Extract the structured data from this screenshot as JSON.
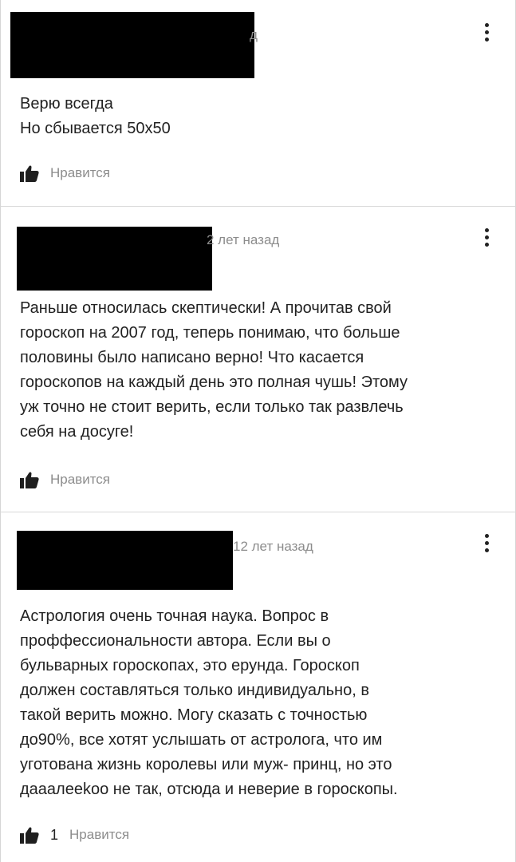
{
  "comments": [
    {
      "time": "д",
      "lines": [
        "Верю всегда",
        "Но сбывается 50х50"
      ],
      "likes": {
        "count": "",
        "label": "Нравится"
      }
    },
    {
      "time": "2 лет назад",
      "lines": [
        "Раньше относилась скептически! А прочитав свой",
        "гороскоп на 2007 год, теперь понимаю, что больше",
        "половины было написано верно! Что касается",
        "гороскопов на каждый день это полная чушь! Этому",
        "уж точно не стоит верить, если только так развлечь",
        "себя на досуге!"
      ],
      "likes": {
        "count": "",
        "label": "Нравится"
      }
    },
    {
      "time": "12 лет назад",
      "lines": [
        "Астрология очень точная наука. Вопрос в",
        "проффессиональности автора. Если вы о",
        "бульварных гороскопах, это ерунда. Гороскоп",
        "должен составляться только индивидуально, в",
        "такой верить можно. Могу сказать с точностью",
        "до90%, все хотят услышать от астролога, что им",
        "уготована жизнь королевы или муж- принц, но это",
        "дааалееkoo не так, отсюда и неверие в гороскопы."
      ],
      "likes": {
        "count": "1",
        "label": "Нравится"
      }
    }
  ],
  "icons": {
    "like": "thumbs-up-icon",
    "menu": "more-vertical-icon"
  }
}
